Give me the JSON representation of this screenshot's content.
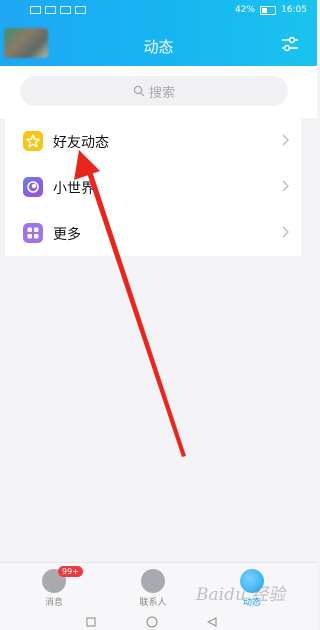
{
  "status_bar": {
    "battery": "42%",
    "time": "16:05"
  },
  "header": {
    "title": "动态",
    "settings_icon": "sliders-icon"
  },
  "search": {
    "placeholder": "搜索"
  },
  "menu": [
    {
      "label": "好友动态",
      "icon": "star-icon",
      "color": "#f7c617"
    },
    {
      "label": "小世界",
      "icon": "world-icon",
      "color": "#7d53e0"
    },
    {
      "label": "更多",
      "icon": "grid-icon",
      "color": "#9f73ea"
    }
  ],
  "tabbar": {
    "messages": {
      "label": "消息",
      "badge": "99+"
    },
    "contacts": {
      "label": "联系人"
    },
    "dynamic": {
      "label": "动态"
    }
  },
  "colors": {
    "header_start": "#1ea7f3",
    "header_end": "#1ac3ee",
    "annotation_arrow": "#e8261f",
    "badge": "#ef3b3b"
  }
}
